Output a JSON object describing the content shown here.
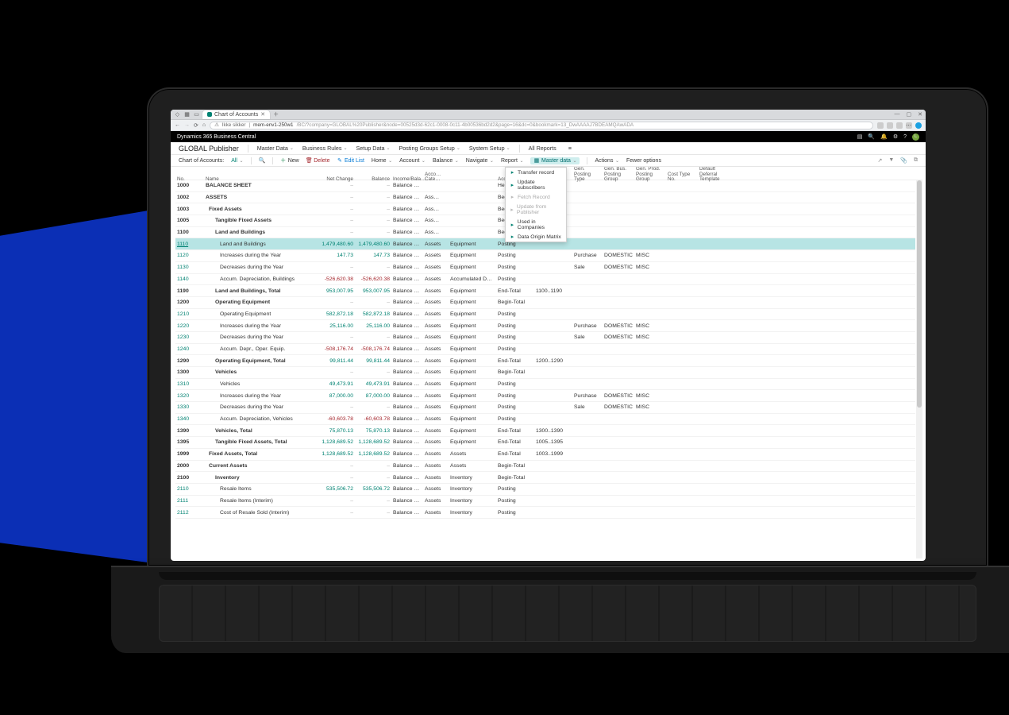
{
  "browser": {
    "tab_title": "Chart of Accounts",
    "url_host": "mem-env1-250w1",
    "url_path": "/BC/?company=GLOBAL%20Publisher&node=00525d3d-62c1-0008-0c11-4b00536bd2d2&page=16&dc=0&bookmark=13_DwAAAAJ7BDEAMQAwADA",
    "security_label": "Ikke sikker"
  },
  "app": {
    "title": "Dynamics 365 Business Central",
    "user_initial": "L"
  },
  "nav": {
    "company": "GLOBAL Publisher",
    "items": [
      "Master Data",
      "Business Rules",
      "Setup Data",
      "Posting Groups Setup",
      "System Setup"
    ],
    "all_reports": "All Reports"
  },
  "ribbon": {
    "context_label": "Chart of Accounts:",
    "all": "All",
    "new": "New",
    "delete": "Delete",
    "edit": "Edit List",
    "groups": [
      "Home",
      "Account",
      "Balance",
      "Navigate",
      "Report"
    ],
    "master_data": "Master data",
    "actions": "Actions",
    "fewer": "Fewer options"
  },
  "dropdown": {
    "items": [
      {
        "label": "Transfer record",
        "disabled": false
      },
      {
        "label": "Update subscribers",
        "disabled": false
      },
      {
        "label": "Fetch Record",
        "disabled": true
      },
      {
        "label": "Update from Publisher",
        "disabled": true
      },
      {
        "label": "Used in Companies",
        "disabled": false
      },
      {
        "label": "Data Origin Matrix",
        "disabled": false
      }
    ]
  },
  "columns": [
    "No.",
    "Name",
    "Net Change",
    "Balance",
    "Income/Bala…",
    "Acco… Cate…",
    "Account Type",
    "Totaling",
    "Gen. Posting Type",
    "Gen. Bus. Posting Group",
    "Gen. Prod. Posting Group",
    "Cost Type No.",
    "Default Deferral Template"
  ],
  "rows": [
    {
      "no": "1000",
      "name": "BALANCE SHEET",
      "net": "–",
      "bal": "–",
      "ib": "Balance Sheet",
      "cat": "",
      "atype": "Heading",
      "tot": "",
      "bold": true,
      "link": false,
      "ind": 0
    },
    {
      "no": "1002",
      "name": "ASSETS",
      "net": "–",
      "bal": "–",
      "ib": "Balance Sheet",
      "cat": "Ass…",
      "atype": "Begin-Total",
      "tot": "",
      "bold": true,
      "link": false,
      "ind": 0
    },
    {
      "no": "1003",
      "name": "Fixed Assets",
      "net": "–",
      "bal": "–",
      "ib": "Balance Sheet",
      "cat": "Ass…",
      "atype": "Begin-Total",
      "tot": "",
      "bold": true,
      "link": false,
      "ind": 1
    },
    {
      "no": "1005",
      "name": "Tangible Fixed Assets",
      "net": "–",
      "bal": "–",
      "ib": "Balance Sheet",
      "cat": "Ass…",
      "atype": "Begin-Total",
      "tot": "",
      "bold": true,
      "link": false,
      "ind": 2
    },
    {
      "no": "1100",
      "name": "Land and Buildings",
      "net": "–",
      "bal": "–",
      "ib": "Balance Sheet",
      "cat": "Ass…",
      "atype": "Begin-Total",
      "tot": "",
      "bold": true,
      "link": false,
      "ind": 2
    },
    {
      "no": "1110",
      "name": "Land and Buildings",
      "net": "1,479,480.60",
      "bal": "1,479,480.60",
      "ib": "Balance Sheet",
      "cat": "Assets",
      "sub": "Equipment",
      "atype": "Posting",
      "tot": "",
      "link": true,
      "ind": 3,
      "sel": true,
      "und": true
    },
    {
      "no": "1120",
      "name": "Increases during the Year",
      "net": "147.73",
      "bal": "147.73",
      "ib": "Balance Sheet",
      "cat": "Assets",
      "sub": "Equipment",
      "atype": "Posting",
      "tot": "",
      "gpt": "Purchase",
      "gbg": "DOMESTIC",
      "gpg": "MISC",
      "link": true,
      "ind": 3
    },
    {
      "no": "1130",
      "name": "Decreases during the Year",
      "net": "–",
      "bal": "–",
      "ib": "Balance Sheet",
      "cat": "Assets",
      "sub": "Equipment",
      "atype": "Posting",
      "tot": "",
      "gpt": "Sale",
      "gbg": "DOMESTIC",
      "gpg": "MISC",
      "link": true,
      "ind": 3
    },
    {
      "no": "1140",
      "name": "Accum. Depreciation, Buildings",
      "net": "-526,620.38",
      "bal": "-526,620.38",
      "ib": "Balance Sheet",
      "cat": "Assets",
      "sub": "Accumulated Depreciation",
      "atype": "Posting",
      "tot": "",
      "neg": true,
      "link": true,
      "ind": 3
    },
    {
      "no": "1190",
      "name": "Land and Buildings, Total",
      "net": "953,007.95",
      "bal": "953,007.95",
      "ib": "Balance Sheet",
      "cat": "Assets",
      "sub": "Equipment",
      "atype": "End-Total",
      "tot": "1100..1190",
      "bold": true,
      "link": false,
      "ind": 2
    },
    {
      "no": "1200",
      "name": "Operating Equipment",
      "net": "–",
      "bal": "–",
      "ib": "Balance Sheet",
      "cat": "Assets",
      "sub": "Equipment",
      "atype": "Begin-Total",
      "tot": "",
      "bold": true,
      "link": false,
      "ind": 2
    },
    {
      "no": "1210",
      "name": "Operating Equipment",
      "net": "582,872.18",
      "bal": "582,872.18",
      "ib": "Balance Sheet",
      "cat": "Assets",
      "sub": "Equipment",
      "atype": "Posting",
      "tot": "",
      "link": true,
      "ind": 3
    },
    {
      "no": "1220",
      "name": "Increases during the Year",
      "net": "25,116.00",
      "bal": "25,116.00",
      "ib": "Balance Sheet",
      "cat": "Assets",
      "sub": "Equipment",
      "atype": "Posting",
      "tot": "",
      "gpt": "Purchase",
      "gbg": "DOMESTIC",
      "gpg": "MISC",
      "link": true,
      "ind": 3
    },
    {
      "no": "1230",
      "name": "Decreases during the Year",
      "net": "–",
      "bal": "–",
      "ib": "Balance Sheet",
      "cat": "Assets",
      "sub": "Equipment",
      "atype": "Posting",
      "tot": "",
      "gpt": "Sale",
      "gbg": "DOMESTIC",
      "gpg": "MISC",
      "link": true,
      "ind": 3
    },
    {
      "no": "1240",
      "name": "Accum. Depr., Oper. Equip.",
      "net": "-508,176.74",
      "bal": "-508,176.74",
      "ib": "Balance Sheet",
      "cat": "Assets",
      "sub": "Equipment",
      "atype": "Posting",
      "tot": "",
      "neg": true,
      "link": true,
      "ind": 3
    },
    {
      "no": "1290",
      "name": "Operating Equipment, Total",
      "net": "99,811.44",
      "bal": "99,811.44",
      "ib": "Balance Sheet",
      "cat": "Assets",
      "sub": "Equipment",
      "atype": "End-Total",
      "tot": "1200..1290",
      "bold": true,
      "link": false,
      "ind": 2
    },
    {
      "no": "1300",
      "name": "Vehicles",
      "net": "–",
      "bal": "–",
      "ib": "Balance Sheet",
      "cat": "Assets",
      "sub": "Equipment",
      "atype": "Begin-Total",
      "tot": "",
      "bold": true,
      "link": false,
      "ind": 2
    },
    {
      "no": "1310",
      "name": "Vehicles",
      "net": "49,473.91",
      "bal": "49,473.91",
      "ib": "Balance Sheet",
      "cat": "Assets",
      "sub": "Equipment",
      "atype": "Posting",
      "tot": "",
      "link": true,
      "ind": 3
    },
    {
      "no": "1320",
      "name": "Increases during the Year",
      "net": "87,000.00",
      "bal": "87,000.00",
      "ib": "Balance Sheet",
      "cat": "Assets",
      "sub": "Equipment",
      "atype": "Posting",
      "tot": "",
      "gpt": "Purchase",
      "gbg": "DOMESTIC",
      "gpg": "MISC",
      "link": true,
      "ind": 3
    },
    {
      "no": "1330",
      "name": "Decreases during the Year",
      "net": "–",
      "bal": "–",
      "ib": "Balance Sheet",
      "cat": "Assets",
      "sub": "Equipment",
      "atype": "Posting",
      "tot": "",
      "gpt": "Sale",
      "gbg": "DOMESTIC",
      "gpg": "MISC",
      "link": true,
      "ind": 3
    },
    {
      "no": "1340",
      "name": "Accum. Depreciation, Vehicles",
      "net": "-60,603.78",
      "bal": "-60,603.78",
      "ib": "Balance Sheet",
      "cat": "Assets",
      "sub": "Equipment",
      "atype": "Posting",
      "tot": "",
      "neg": true,
      "link": true,
      "ind": 3
    },
    {
      "no": "1390",
      "name": "Vehicles, Total",
      "net": "75,870.13",
      "bal": "75,870.13",
      "ib": "Balance Sheet",
      "cat": "Assets",
      "sub": "Equipment",
      "atype": "End-Total",
      "tot": "1300..1390",
      "bold": true,
      "link": false,
      "ind": 2
    },
    {
      "no": "1395",
      "name": "Tangible Fixed Assets, Total",
      "net": "1,128,689.52",
      "bal": "1,128,689.52",
      "ib": "Balance Sheet",
      "cat": "Assets",
      "sub": "Equipment",
      "atype": "End-Total",
      "tot": "1005..1395",
      "bold": true,
      "link": false,
      "ind": 2
    },
    {
      "no": "1999",
      "name": "Fixed Assets, Total",
      "net": "1,128,689.52",
      "bal": "1,128,689.52",
      "ib": "Balance Sheet",
      "cat": "Assets",
      "sub": "Assets",
      "atype": "End-Total",
      "tot": "1003..1999",
      "bold": true,
      "link": false,
      "ind": 1
    },
    {
      "no": "2000",
      "name": "Current Assets",
      "net": "–",
      "bal": "–",
      "ib": "Balance Sheet",
      "cat": "Assets",
      "sub": "Assets",
      "atype": "Begin-Total",
      "tot": "",
      "bold": true,
      "link": false,
      "ind": 1
    },
    {
      "no": "2100",
      "name": "Inventory",
      "net": "–",
      "bal": "–",
      "ib": "Balance Sheet",
      "cat": "Assets",
      "sub": "Inventory",
      "atype": "Begin-Total",
      "tot": "",
      "bold": true,
      "link": false,
      "ind": 2
    },
    {
      "no": "2110",
      "name": "Resale Items",
      "net": "535,506.72",
      "bal": "535,506.72",
      "ib": "Balance Sheet",
      "cat": "Assets",
      "sub": "Inventory",
      "atype": "Posting",
      "tot": "",
      "link": true,
      "ind": 3
    },
    {
      "no": "2111",
      "name": "Resale Items (Interim)",
      "net": "–",
      "bal": "–",
      "ib": "Balance Sheet",
      "cat": "Assets",
      "sub": "Inventory",
      "atype": "Posting",
      "tot": "",
      "link": true,
      "ind": 3
    },
    {
      "no": "2112",
      "name": "Cost of Resale Sold (Interim)",
      "net": "–",
      "bal": "–",
      "ib": "Balance Sheet",
      "cat": "Assets",
      "sub": "Inventory",
      "atype": "Posting",
      "tot": "",
      "link": true,
      "ind": 3
    }
  ]
}
